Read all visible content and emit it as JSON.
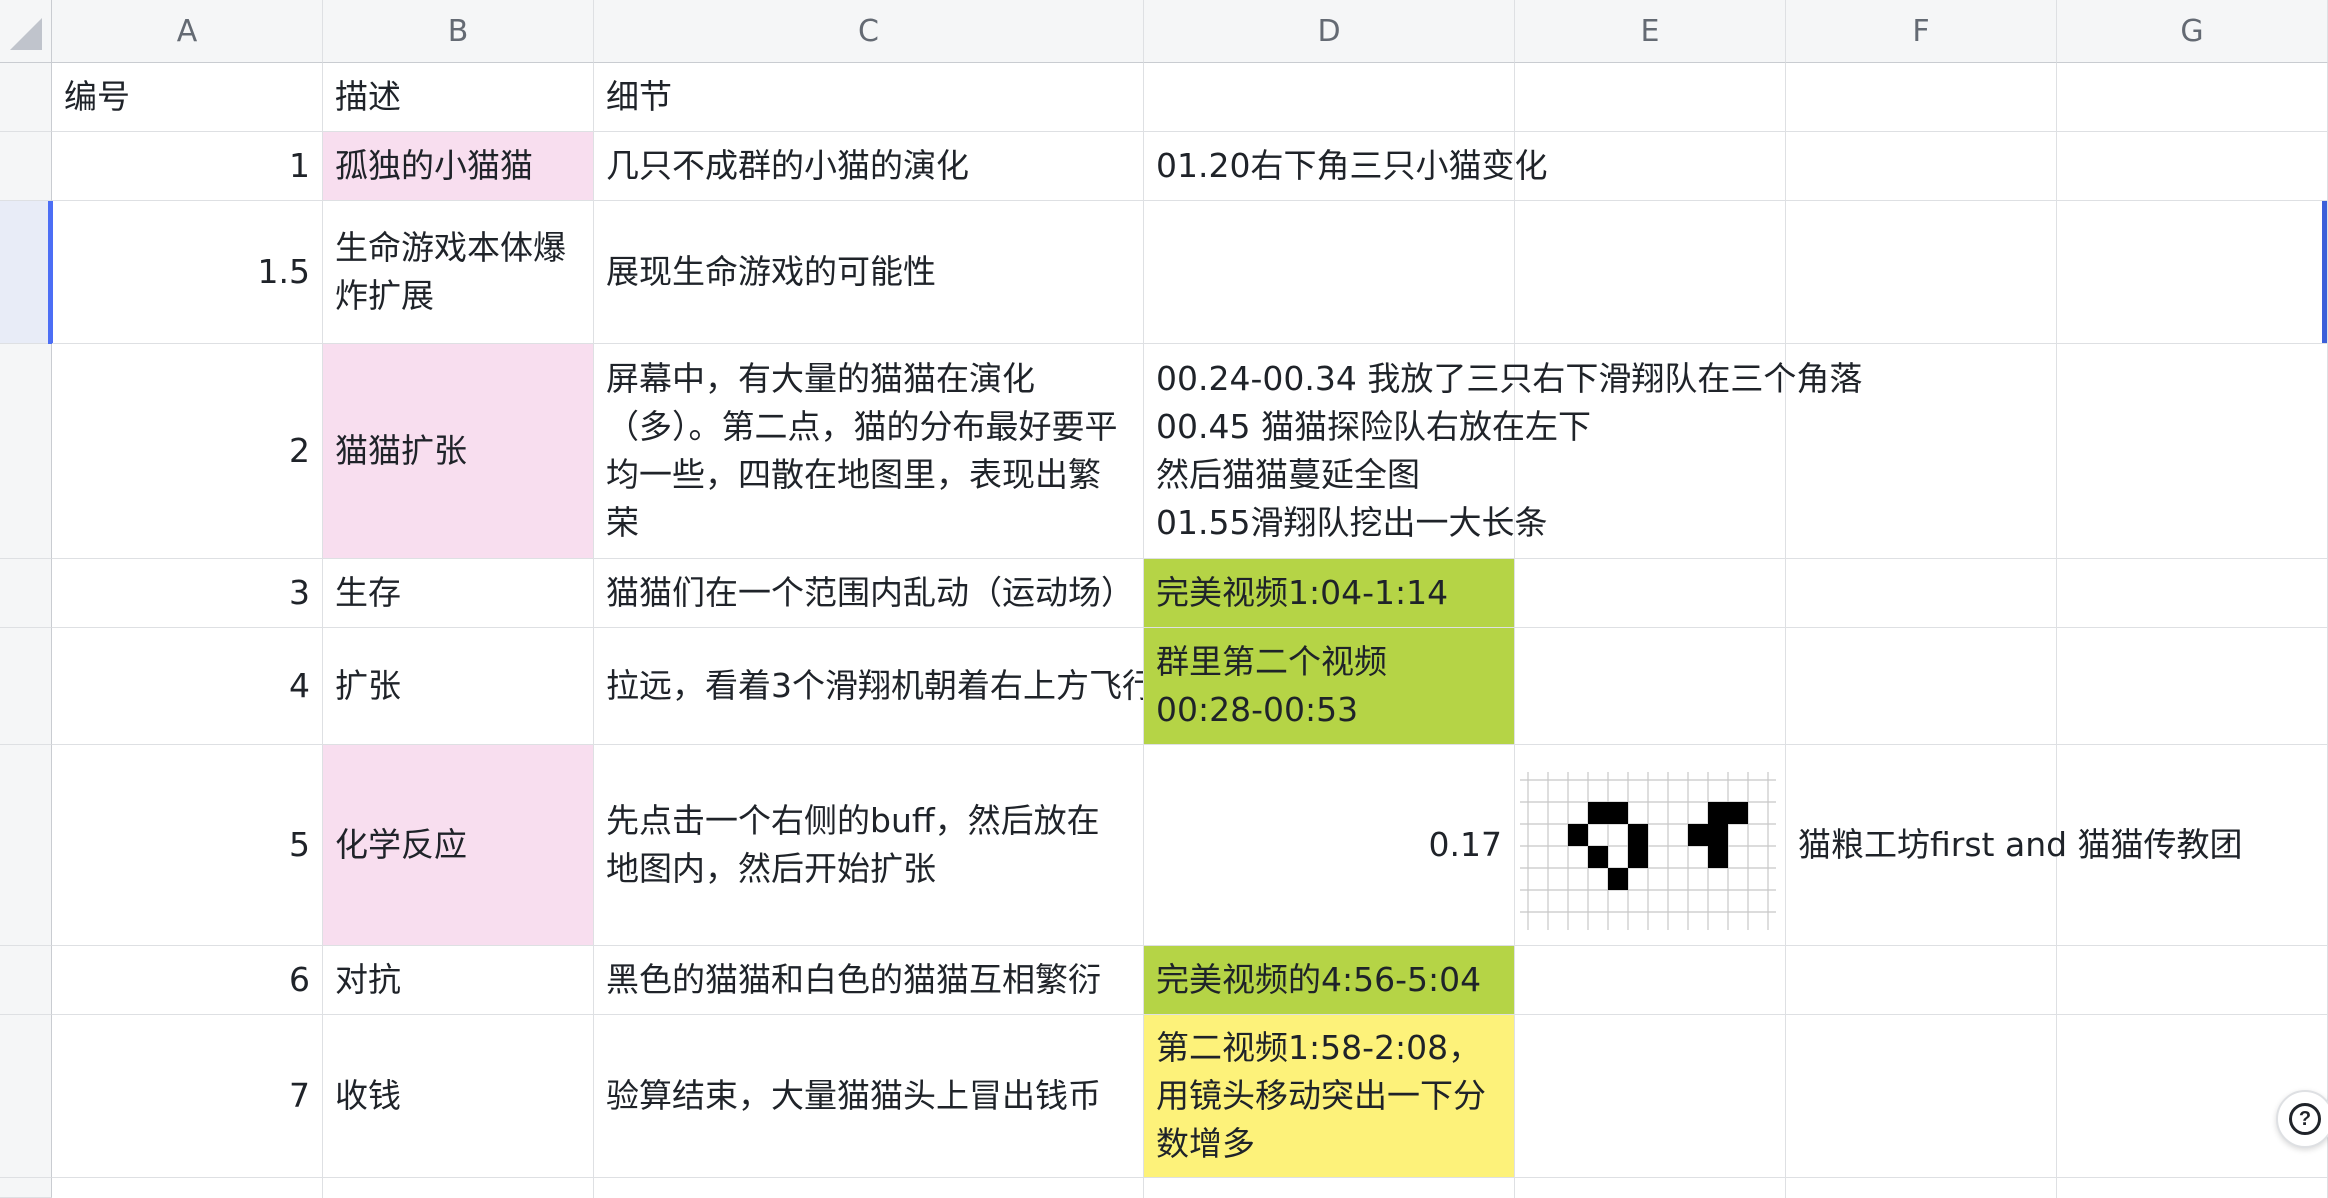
{
  "columns": [
    "A",
    "B",
    "C",
    "D",
    "E",
    "F",
    "G"
  ],
  "rows": [
    {
      "id": "",
      "a": "编号",
      "b": "描述",
      "c": "细节",
      "d": "",
      "f": ""
    },
    {
      "id": "",
      "a": "1",
      "b": "孤独的小猫猫",
      "c": "几只不成群的小猫的演化",
      "d": "01.20右下角三只小猫变化",
      "f": ""
    },
    {
      "id": "",
      "a": "1.5",
      "b": "生命游戏本体爆炸扩展",
      "c": "展现生命游戏的可能性",
      "d": "",
      "f": ""
    },
    {
      "id": "",
      "a": "2",
      "b": "猫猫扩张",
      "c": "屏幕中，有大量的猫猫在演化（多）。第二点，猫的分布最好要平均一些，四散在地图里，表现出繁荣",
      "d": "",
      "f": ""
    },
    {
      "id": "",
      "a": "3",
      "b": "生存",
      "c": "猫猫们在一个范围内乱动（运动场）",
      "d": "完美视频1:04-1:14",
      "f": ""
    },
    {
      "id": "",
      "a": "4",
      "b": "扩张",
      "c": "拉远，看着3个滑翔机朝着右上方飞行",
      "d": "群里第二个视频 00:28-00:53",
      "f": ""
    },
    {
      "id": "",
      "a": "5",
      "b": "化学反应",
      "c": "先点击一个右侧的buff，然后放在地图内，然后开始扩张",
      "d": "0.17",
      "f": "猫粮工坊first and 猫猫传教团"
    },
    {
      "id": "",
      "a": "6",
      "b": "对抗",
      "c": "黑色的猫猫和白色的猫猫互相繁衍",
      "d": "完美视频的4:56-5:04",
      "f": ""
    },
    {
      "id": "",
      "a": "7",
      "b": "收钱",
      "c": "验算结束，大量猫猫头上冒出钱币",
      "d": "第二视频1:58-2:08，用镜头移动突出一下分数增多",
      "f": ""
    }
  ],
  "row2_details": [
    "00.24-00.34 我放了三只右下滑翔队在三个角落",
    "00.45 猫猫探险队右放在左下",
    "然后猫猫蔓延全图",
    "01.55滑翔队挖出一大长条"
  ],
  "colors": {
    "pink": "#f8deef",
    "green": "#b5d446",
    "yellow": "#fdf27a",
    "selection": "#4c6ef5"
  },
  "icons": {
    "help": "question-mark-icon",
    "corner": "select-all-triangle-icon"
  }
}
